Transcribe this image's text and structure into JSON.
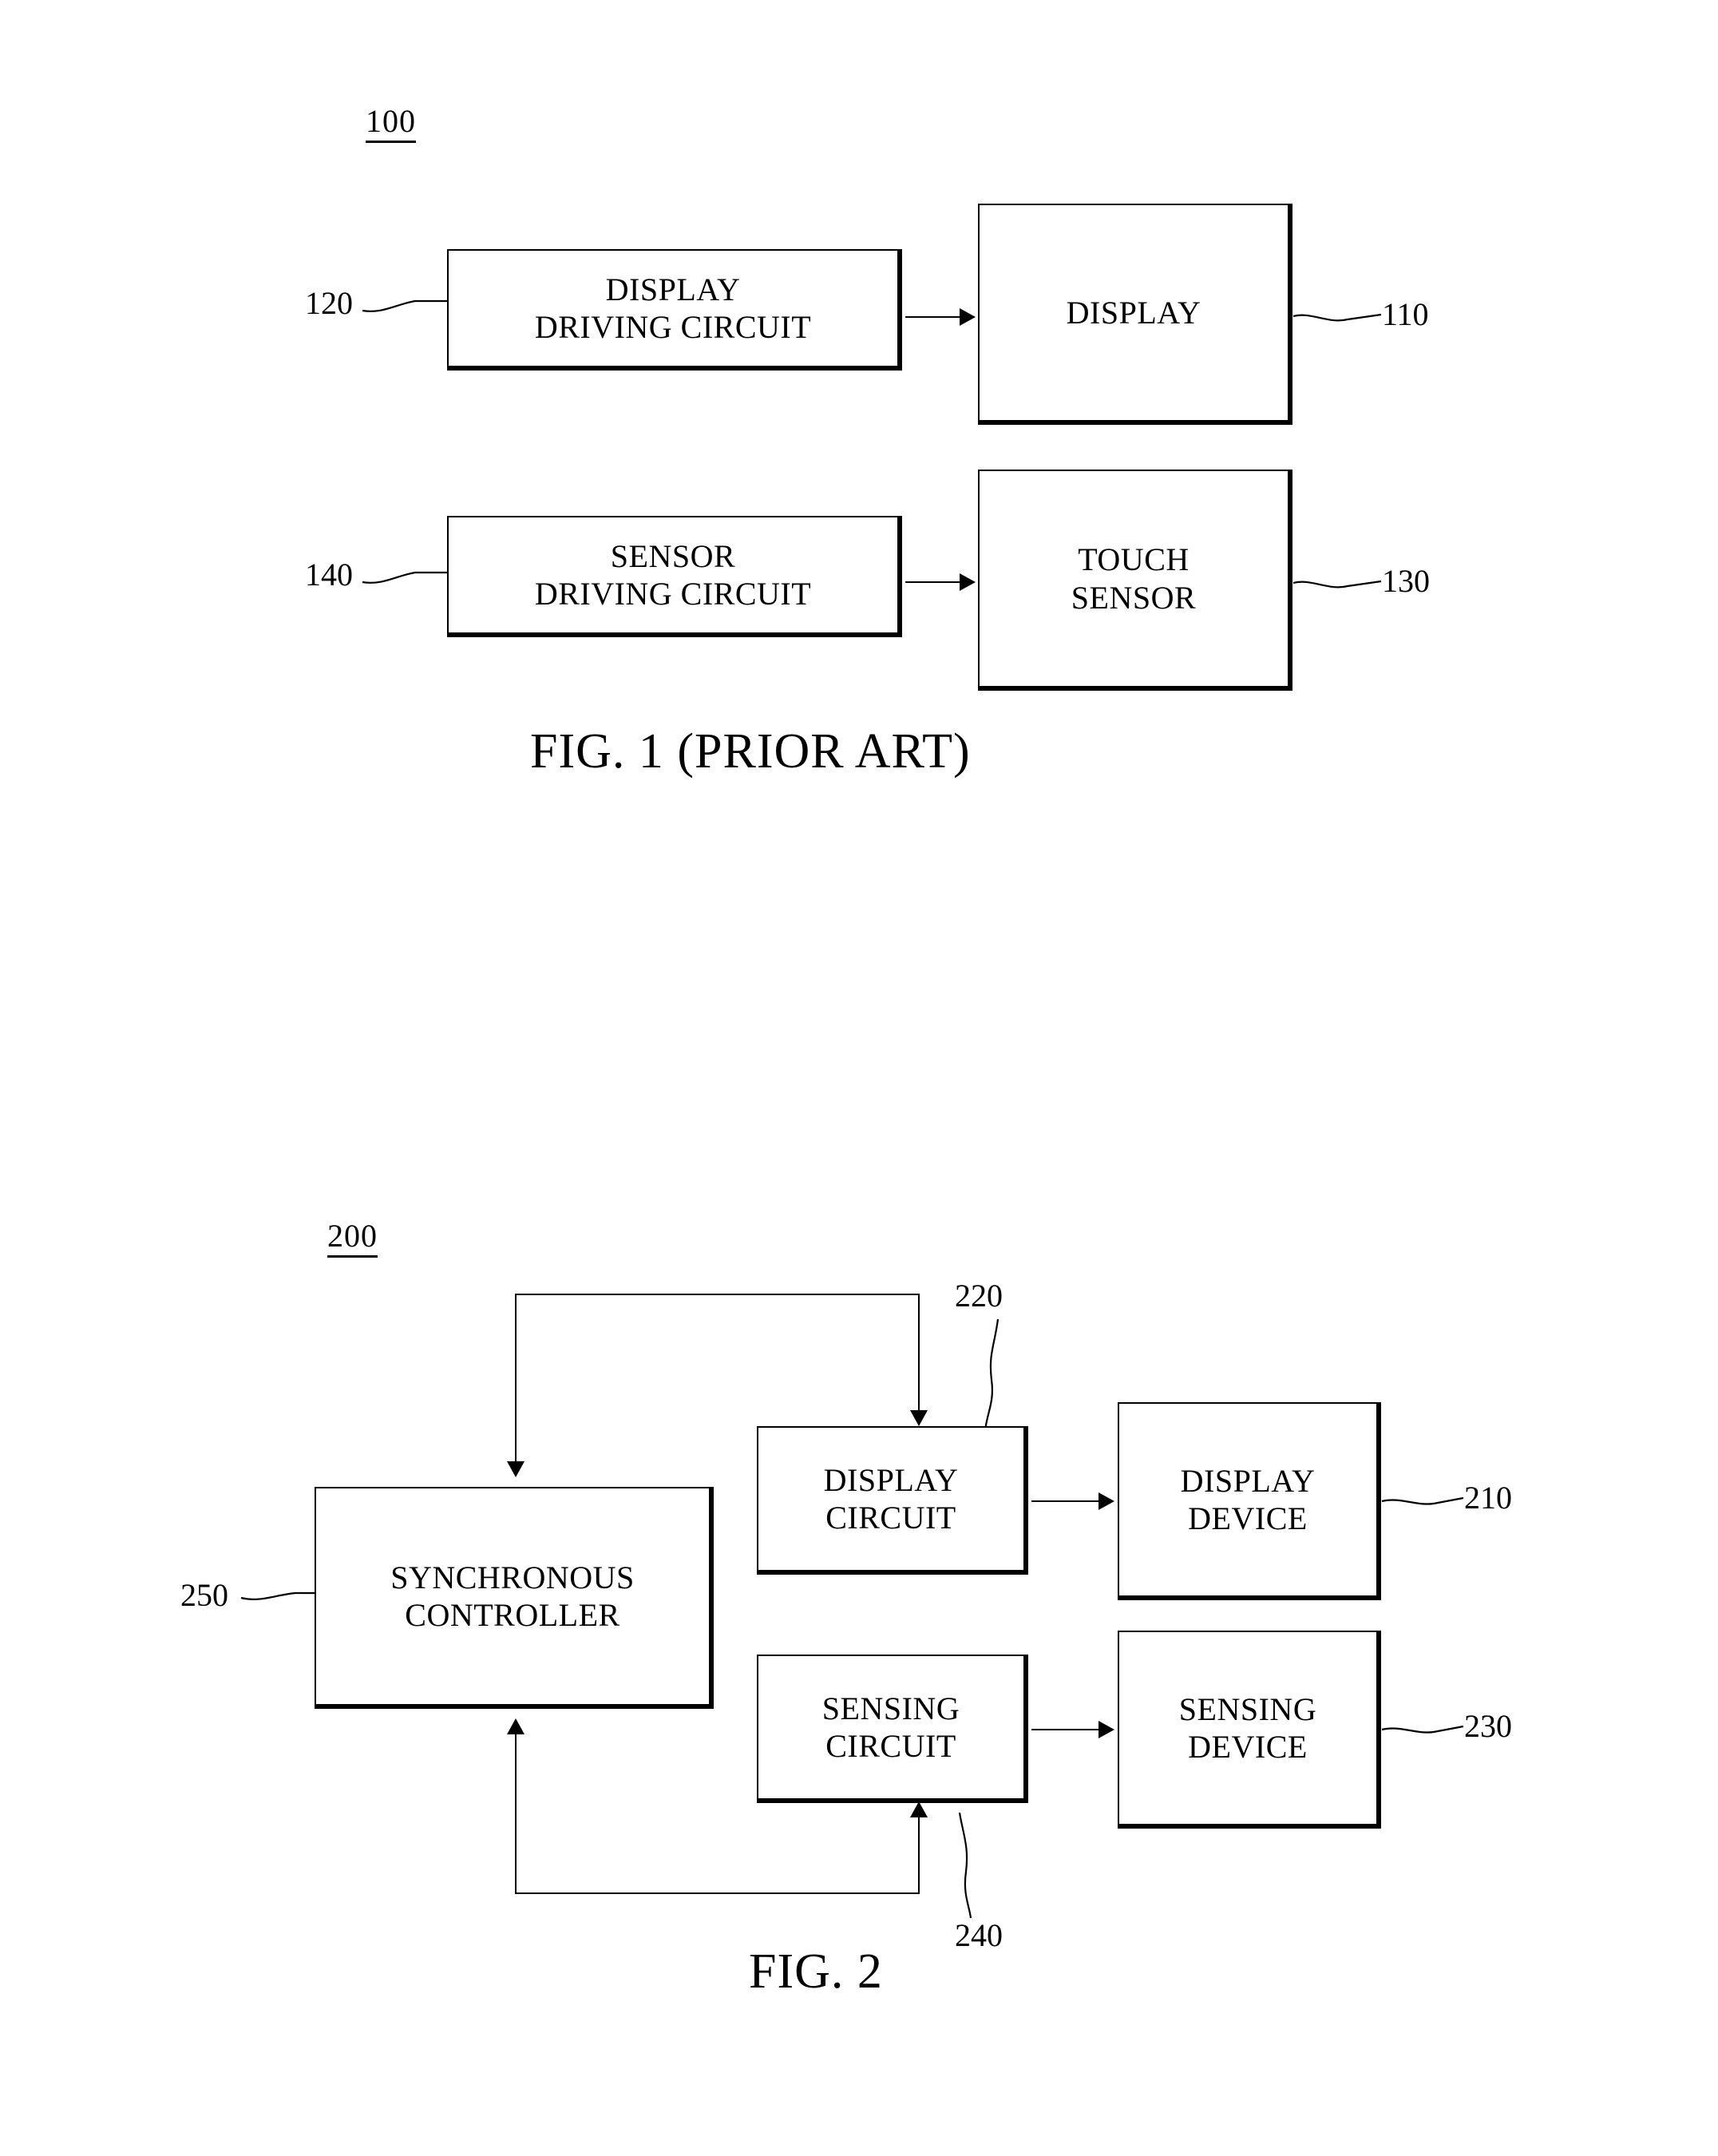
{
  "document": {
    "type": "patent-drawing-sheet",
    "figure_count": 2
  },
  "figure1": {
    "system_ref": "100",
    "caption": "FIG. 1 (PRIOR ART)",
    "blocks": [
      {
        "id": "display-driving-circuit",
        "label": "DISPLAY\nDRIVING CIRCUIT",
        "ref": "120"
      },
      {
        "id": "display",
        "label": "DISPLAY",
        "ref": "110"
      },
      {
        "id": "sensor-driving-circuit",
        "label": "SENSOR\nDRIVING CIRCUIT",
        "ref": "140"
      },
      {
        "id": "touch-sensor",
        "label": "TOUCH\nSENSOR",
        "ref": "130"
      }
    ],
    "connections": [
      {
        "from": "display-driving-circuit",
        "to": "display",
        "direction": "right"
      },
      {
        "from": "sensor-driving-circuit",
        "to": "touch-sensor",
        "direction": "right"
      }
    ]
  },
  "figure2": {
    "system_ref": "200",
    "caption": "FIG. 2",
    "blocks": [
      {
        "id": "synchronous-controller",
        "label": "SYNCHRONOUS\nCONTROLLER",
        "ref": "250"
      },
      {
        "id": "display-circuit",
        "label": "DISPLAY\nCIRCUIT",
        "ref": "220"
      },
      {
        "id": "display-device",
        "label": "DISPLAY\nDEVICE",
        "ref": "210"
      },
      {
        "id": "sensing-circuit",
        "label": "SENSING\nCIRCUIT",
        "ref": "240"
      },
      {
        "id": "sensing-device",
        "label": "SENSING\nDEVICE",
        "ref": "230"
      }
    ],
    "connections": [
      {
        "from": "display-circuit",
        "to": "display-device",
        "direction": "right"
      },
      {
        "from": "sensing-circuit",
        "to": "sensing-device",
        "direction": "right"
      },
      {
        "from": "synchronous-controller",
        "to": "display-circuit",
        "direction": "top-loop-down"
      },
      {
        "from": "sensing-circuit",
        "to": "synchronous-controller",
        "direction": "bottom-loop-up"
      }
    ]
  }
}
